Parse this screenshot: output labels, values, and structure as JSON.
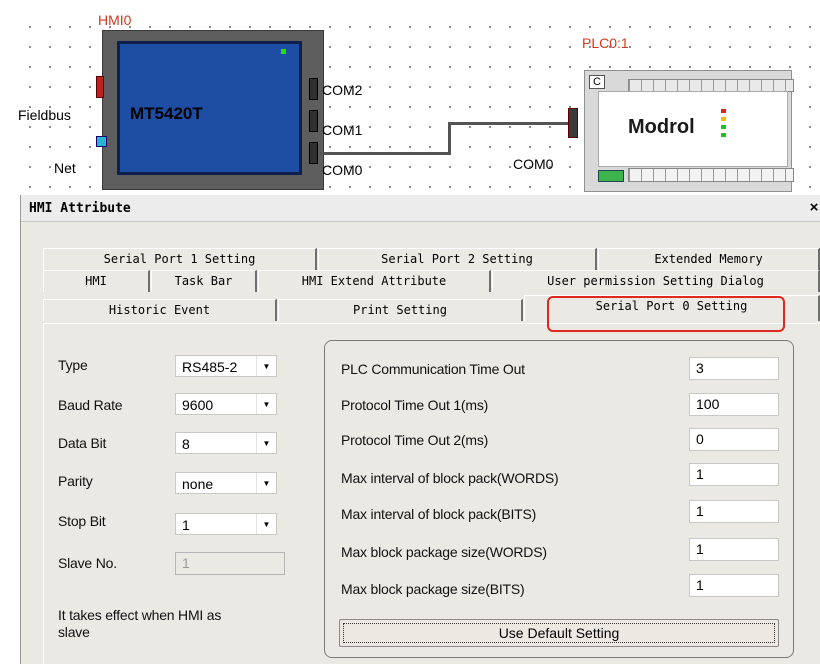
{
  "canvas": {
    "hmi_name": "HMI0",
    "hmi_model": "MT5420T",
    "fieldbus_label": "Fieldbus",
    "net_label": "Net",
    "com2_label": "COM2",
    "com1_label": "COM1",
    "com0_label": "COM0",
    "plc_name": "PLC0:1",
    "plc_com_label": "COM0",
    "plc_brand": "Modrol"
  },
  "dialog": {
    "title": "HMI Attribute",
    "close_glyph": "×",
    "tabs_row1": [
      "Serial Port 1 Setting",
      "Serial Port 2 Setting",
      "Extended Memory"
    ],
    "tabs_row2": [
      "HMI",
      "Task Bar",
      "HMI Extend Attribute",
      "User permission Setting Dialog"
    ],
    "tabs_row3": [
      "Historic Event",
      "Print Setting",
      "Serial Port 0 Setting"
    ],
    "active_tab": "Serial Port 0 Setting",
    "left": {
      "type_label": "Type",
      "type_value": "RS485-2",
      "baud_label": "Baud Rate",
      "baud_value": "9600",
      "databit_label": "Data Bit",
      "databit_value": "8",
      "parity_label": "Parity",
      "parity_value": "none",
      "stopbit_label": "Stop Bit",
      "stopbit_value": "1",
      "slave_label": "Slave No.",
      "slave_value": "1",
      "note_line1": "It takes effect when HMI as",
      "note_line2": "slave"
    },
    "right": {
      "fields": [
        {
          "label": "PLC Communication Time Out",
          "value": "3"
        },
        {
          "label": "Protocol Time Out 1(ms)",
          "value": "100"
        },
        {
          "label": "Protocol Time Out 2(ms)",
          "value": "0"
        },
        {
          "label": "Max interval of block pack(WORDS)",
          "value": "1"
        },
        {
          "label": "Max interval of block pack(BITS)",
          "value": "1"
        },
        {
          "label": "Max block package size(WORDS)",
          "value": "1"
        },
        {
          "label": "Max block package size(BITS)",
          "value": "1"
        }
      ],
      "default_button": "Use Default Setting"
    },
    "highlight_color": "#e0291e"
  }
}
